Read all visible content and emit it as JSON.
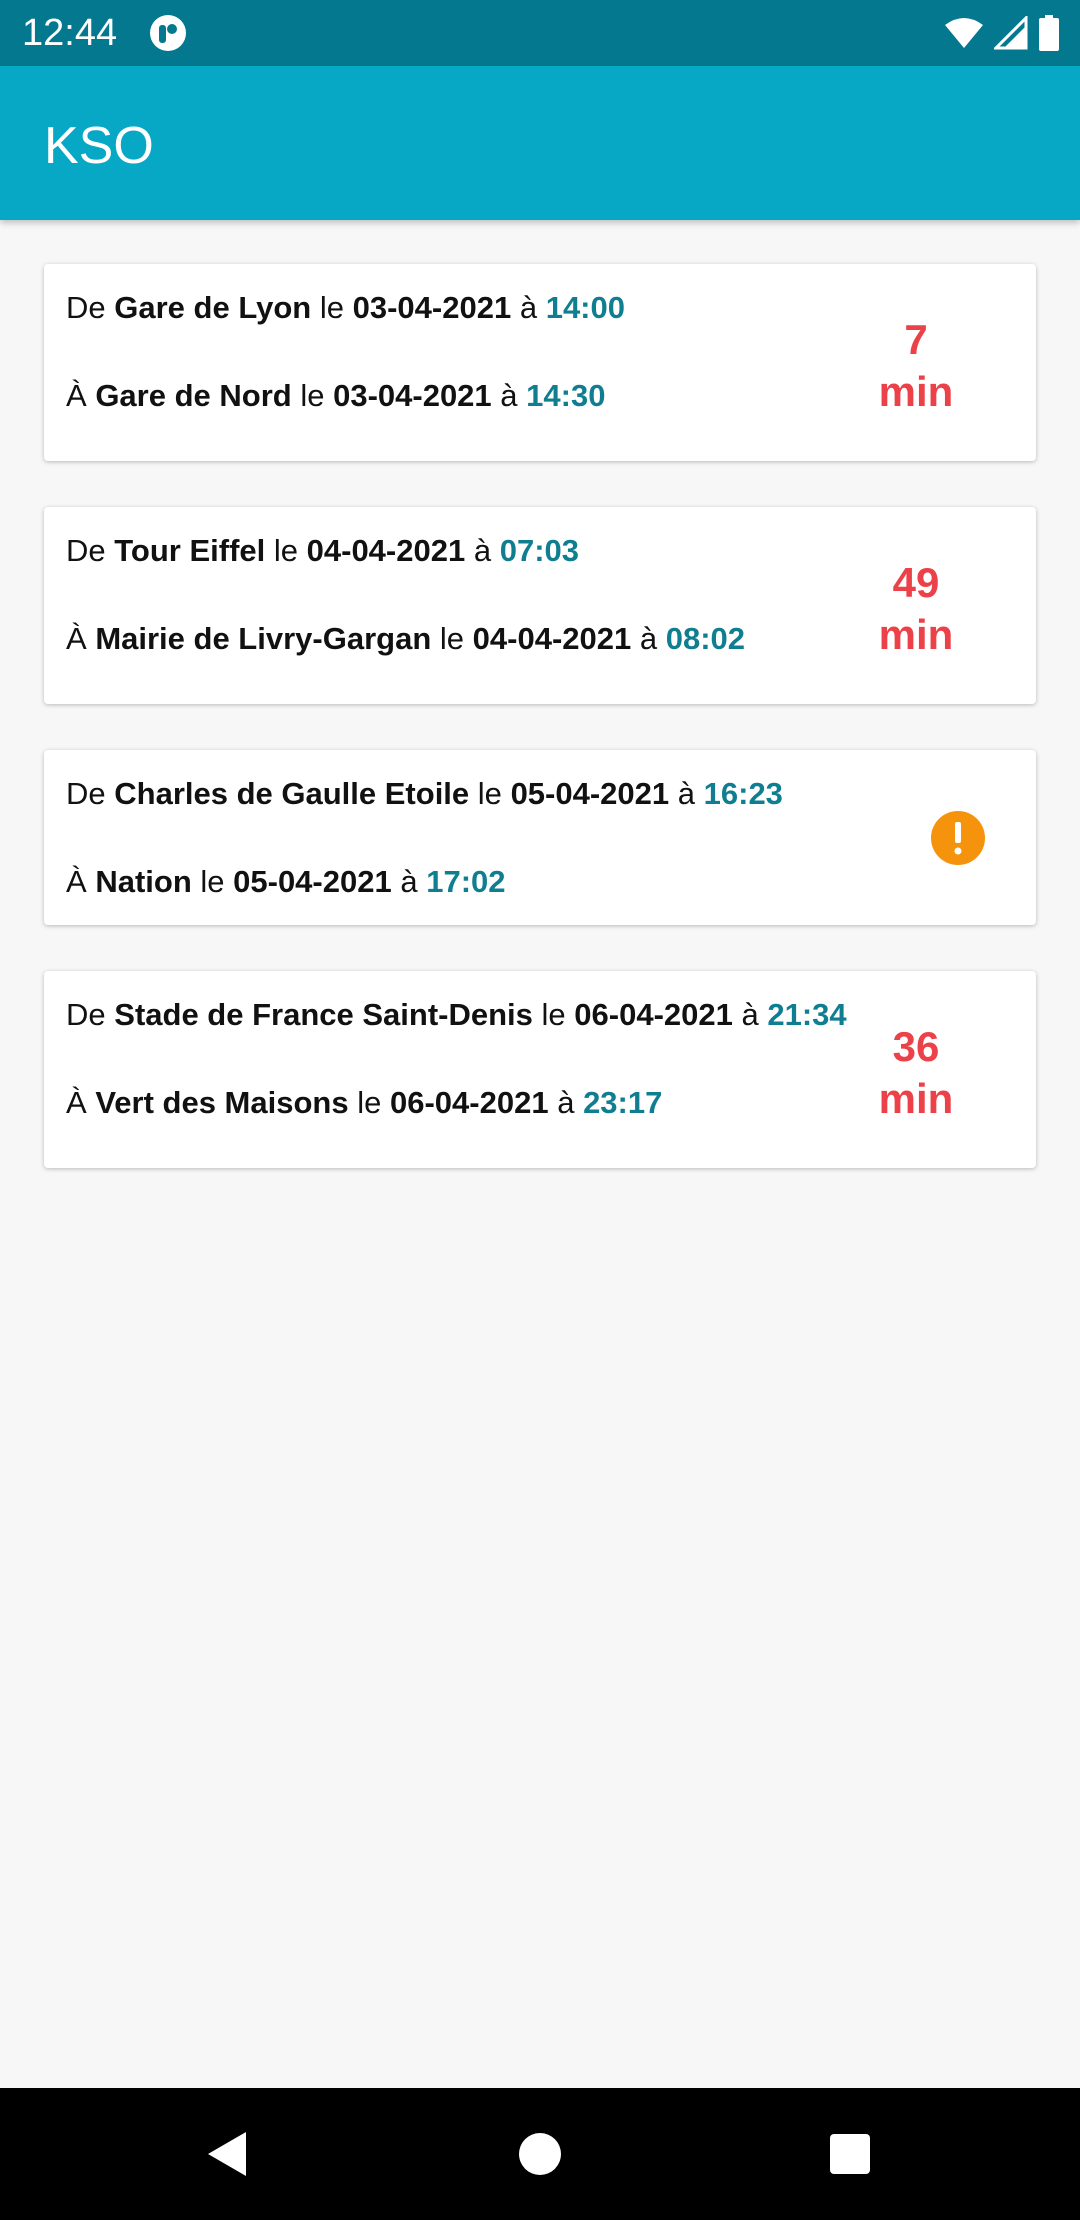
{
  "status_bar": {
    "time": "12:44",
    "icons": [
      "app-notification-icon",
      "wifi-icon",
      "cell-signal-icon",
      "battery-icon"
    ]
  },
  "app_bar": {
    "title": "KSO"
  },
  "labels": {
    "from": "De",
    "to": "À",
    "on": "le",
    "at": "à"
  },
  "trips": [
    {
      "from_station": "Gare de Lyon",
      "from_date": "03-04-2021",
      "from_time": "14:00",
      "to_station": "Gare de Nord",
      "to_date": "03-04-2021",
      "to_time": "14:30",
      "duration_value": "7",
      "duration_unit": "min"
    },
    {
      "from_station": "Tour Eiffel",
      "from_date": "04-04-2021",
      "from_time": "07:03",
      "to_station": "Mairie de Livry-Gargan",
      "to_date": "04-04-2021",
      "to_time": "08:02",
      "duration_value": "49",
      "duration_unit": "min"
    },
    {
      "from_station": "Charles de Gaulle Etoile",
      "from_date": "05-04-2021",
      "from_time": "16:23",
      "to_station": "Nation",
      "to_date": "05-04-2021",
      "to_time": "17:02",
      "status_icon": "warning-icon"
    },
    {
      "from_station": "Stade de France Saint-Denis",
      "from_date": "06-04-2021",
      "from_time": "21:34",
      "to_station": "Vert des Maisons",
      "to_date": "06-04-2021",
      "to_time": "23:17",
      "duration_value": "36",
      "duration_unit": "min"
    }
  ],
  "colors": {
    "status_bar": "#03788f",
    "app_bar": "#07a8c5",
    "time_text": "#0f7e91",
    "duration_text": "#ec4148",
    "warning": "#f5940c",
    "background": "#f6f7f6"
  },
  "nav_bar": {
    "icons": [
      "back-icon",
      "home-icon",
      "recents-icon"
    ]
  }
}
